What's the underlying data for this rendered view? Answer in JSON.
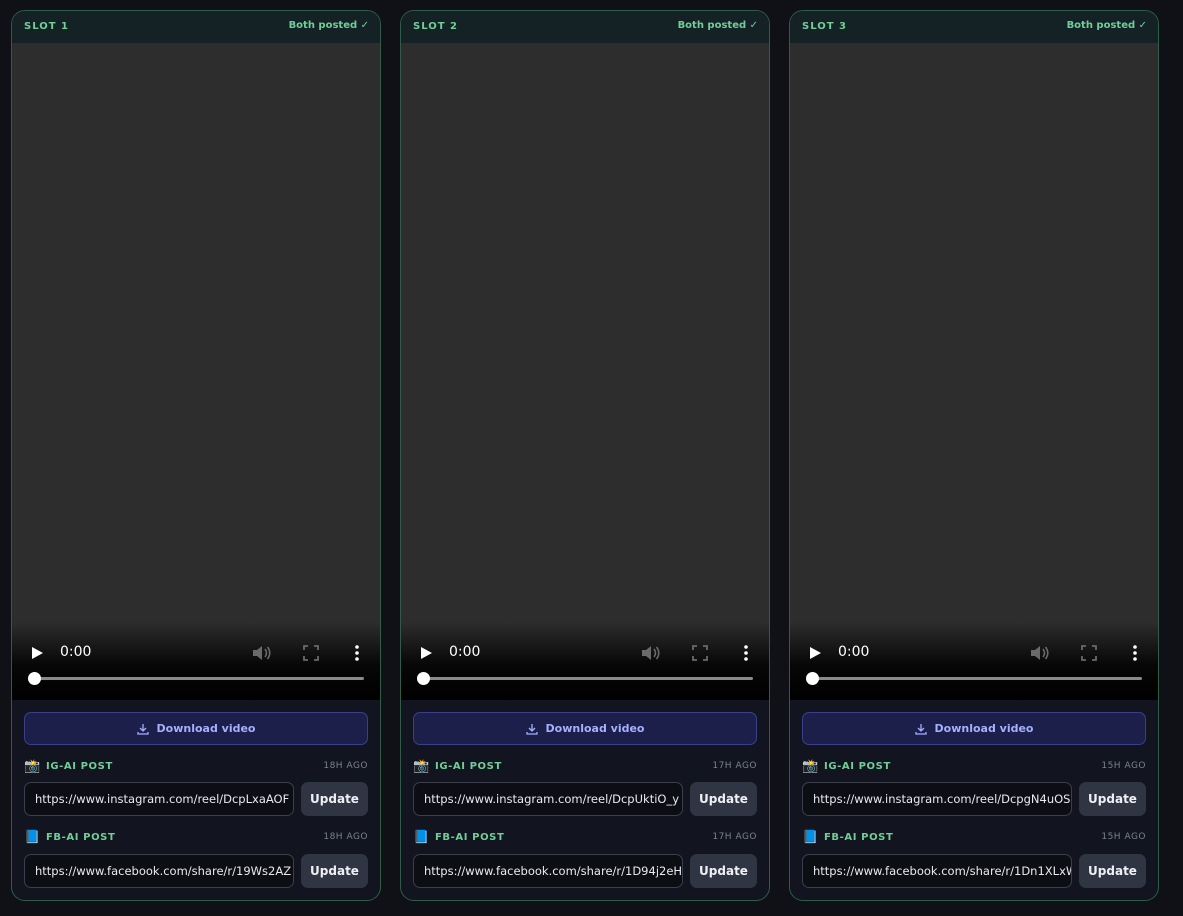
{
  "slots": [
    {
      "title": "SLOT 1",
      "status": "Both posted ✓",
      "video": {
        "time": "0:00",
        "progress": 0
      },
      "download_label": "Download video",
      "ig": {
        "emoji": "📸",
        "label": "IG-AI POST",
        "age": "18H AGO",
        "url": "https://www.instagram.com/reel/DcpLxaAOF",
        "button": "Update"
      },
      "fb": {
        "emoji": "📘",
        "label": "FB-AI POST",
        "age": "18H AGO",
        "url": "https://www.facebook.com/share/r/19Ws2AZ",
        "button": "Update"
      }
    },
    {
      "title": "SLOT 2",
      "status": "Both posted ✓",
      "video": {
        "time": "0:00",
        "progress": 0
      },
      "download_label": "Download video",
      "ig": {
        "emoji": "📸",
        "label": "IG-AI POST",
        "age": "17H AGO",
        "url": "https://www.instagram.com/reel/DcpUktiO_y",
        "button": "Update"
      },
      "fb": {
        "emoji": "📘",
        "label": "FB-AI POST",
        "age": "17H AGO",
        "url": "https://www.facebook.com/share/r/1D94j2eH",
        "button": "Update"
      }
    },
    {
      "title": "SLOT 3",
      "status": "Both posted ✓",
      "video": {
        "time": "0:00",
        "progress": 0
      },
      "download_label": "Download video",
      "ig": {
        "emoji": "📸",
        "label": "IG-AI POST",
        "age": "15H AGO",
        "url": "https://www.instagram.com/reel/DcpgN4uOS",
        "button": "Update"
      },
      "fb": {
        "emoji": "📘",
        "label": "FB-AI POST",
        "age": "15H AGO",
        "url": "https://www.facebook.com/share/r/1Dn1XLxW",
        "button": "Update"
      }
    }
  ],
  "icons": {
    "play": "play-icon",
    "volume": "volume-icon",
    "fullscreen": "fullscreen-icon",
    "more": "more-vertical-icon",
    "download": "download-icon"
  },
  "colors": {
    "accent_green": "#6fcf97",
    "slot_border": "#2e5c48",
    "download_bg": "#1c1f4a",
    "download_text": "#a5b0ff",
    "page_bg": "#0f1117"
  }
}
